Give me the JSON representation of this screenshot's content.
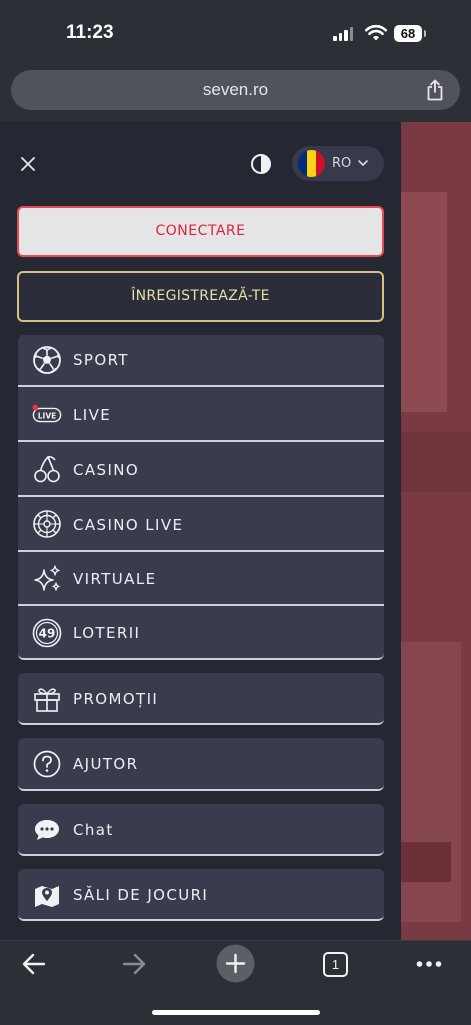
{
  "status_bar": {
    "time": "11:23",
    "battery": "68"
  },
  "browser": {
    "url": "seven.ro",
    "tab_count": "1"
  },
  "menu": {
    "language": {
      "code": "RO",
      "flag_colors": [
        "#002B7F",
        "#FCD116",
        "#CE1126"
      ]
    },
    "login_label": "CONECTARE",
    "register_label": "ÎNREGISTREAZĂ-TE",
    "items": [
      {
        "label": "SPORT",
        "icon": "soccer-ball-icon"
      },
      {
        "label": "LIVE",
        "icon": "live-badge-icon"
      },
      {
        "label": "CASINO",
        "icon": "cherries-icon"
      },
      {
        "label": "CASINO LIVE",
        "icon": "roulette-wheel-icon"
      },
      {
        "label": "VIRTUALE",
        "icon": "sparkles-icon"
      },
      {
        "label": "LOTERII",
        "icon": "lottery-ball-49-icon"
      },
      {
        "label": "PROMOȚII",
        "icon": "gift-icon"
      },
      {
        "label": "AJUTOR",
        "icon": "question-circle-icon"
      },
      {
        "label": "Chat",
        "icon": "chat-bubble-icon"
      },
      {
        "label": "SĂLI DE JOCURI",
        "icon": "map-pin-icon"
      }
    ],
    "live_icon_text": "LIVE",
    "lottery_icon_text": "49"
  },
  "colors": {
    "menu_bg": "#252733",
    "item_bg": "#393c4d",
    "login_border": "#e84a52",
    "register_border": "#d9bf83",
    "live_dot": "#e8304a"
  }
}
